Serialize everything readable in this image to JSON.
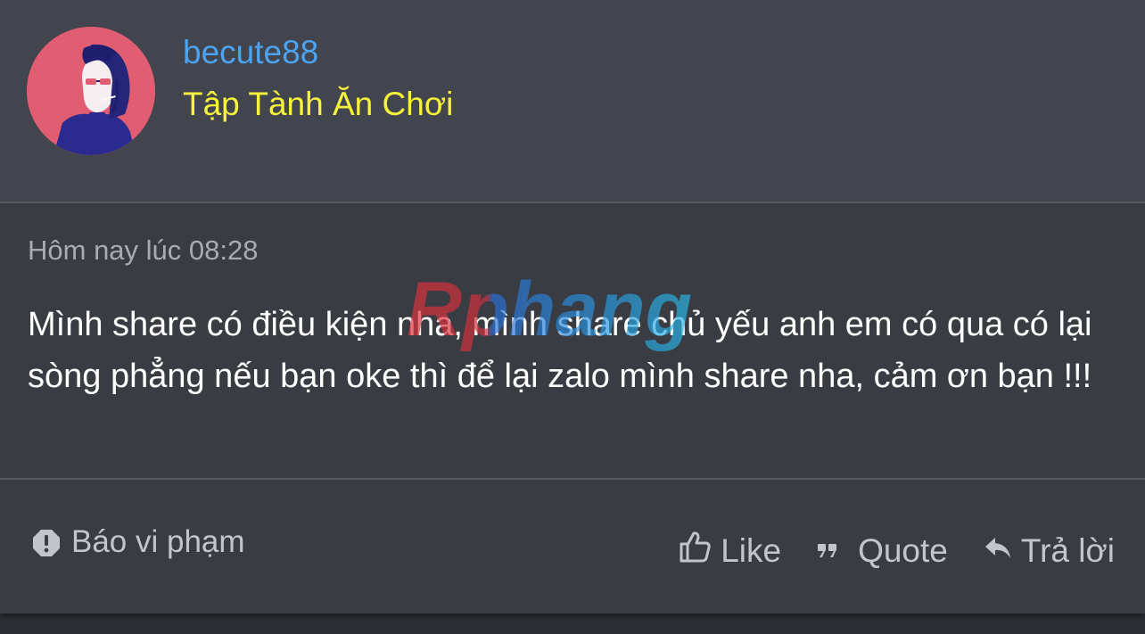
{
  "post": {
    "author": {
      "username": "becute88",
      "title": "Tập Tành Ăn Chơi",
      "avatar_icon": "hooded-smoker-avatar"
    },
    "timestamp": "Hôm nay lúc 08:28",
    "message": "Mình share có điều kiện nha, mình share chủ yếu anh em có qua có lại sòng phẳng nếu bạn oke thì để lại zalo mình share nha, cảm ơn bạn !!!"
  },
  "footer": {
    "report_label": "Báo vi phạm",
    "like_label": "Like",
    "quote_label": "Quote",
    "reply_label": "Trả lời"
  },
  "watermark": {
    "text": "Rphang"
  },
  "colors": {
    "username": "#4ba3f2",
    "user_title": "#f6f33b",
    "header_bg": "#42454d",
    "card_bg": "#393c42",
    "muted_text": "#a8abb0",
    "avatar_bg": "#e05d72"
  }
}
